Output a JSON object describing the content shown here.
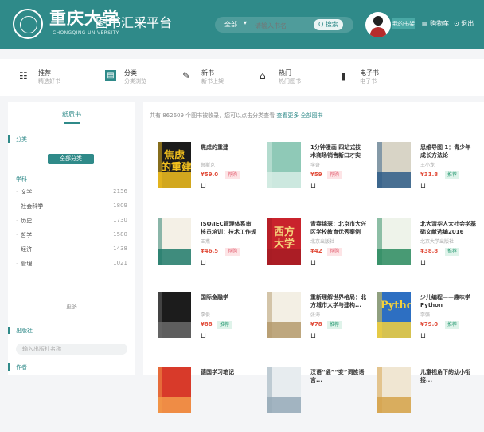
{
  "header": {
    "brand": "重庆大学",
    "brand_sub": "CHONGQING UNIVERSITY",
    "platform": "图书汇采平台",
    "search": {
      "scope": "全部",
      "scope_icon": "chevron-down-icon",
      "placeholder": "请输入书名",
      "button": "Q 搜索"
    },
    "badge": "我的书架",
    "links": [
      "▤ 购物车",
      "⊙ 退出"
    ]
  },
  "categories": [
    {
      "title": "推荐",
      "sub": "精选好书",
      "icon": "grid-icon",
      "glyph": "☷",
      "active": false
    },
    {
      "title": "分类",
      "sub": "分类浏览",
      "icon": "book-icon",
      "glyph": "▤",
      "active": true
    },
    {
      "title": "新书",
      "sub": "新书上架",
      "icon": "new-book-icon",
      "glyph": "✎",
      "active": false
    },
    {
      "title": "热门",
      "sub": "热门图书",
      "icon": "fire-icon",
      "glyph": "⌂",
      "active": false
    },
    {
      "title": "电子书",
      "sub": "电子书",
      "icon": "ebook-icon",
      "glyph": "▮",
      "active": false
    }
  ],
  "sidebar": {
    "title": "纸质书",
    "section1": "分类",
    "all_button": "全部分类",
    "subjects_heading": "学科",
    "subjects": [
      {
        "name": "文学",
        "count": "2156"
      },
      {
        "name": "社会科学",
        "count": "1809"
      },
      {
        "name": "历史",
        "count": "1730"
      },
      {
        "name": "哲学",
        "count": "1580"
      },
      {
        "name": "经济",
        "count": "1438"
      },
      {
        "name": "管理",
        "count": "1021"
      }
    ],
    "more": "更多",
    "section2": "出版社",
    "search_placeholder": "输入出版社名称",
    "section3": "作者"
  },
  "main": {
    "summary": "共有 862609 个图书被收录，您可以点击分类查看",
    "summary_link": "查看更多 全部图书",
    "books": [
      {
        "title": "焦虑的重建",
        "author": "鲁斯克",
        "price": "¥59.0",
        "tag": "荐购",
        "tag_kind": "pink",
        "cover_bg": "#1b1b1b",
        "cover_accent": "#f2c01e",
        "cover_text": "焦虑\n的重建",
        "cover_text_color": "#f2c01e"
      },
      {
        "title": "1分钟漫画 四站式技术商场销售新口才实务...",
        "author": "李奇",
        "price": "¥59",
        "tag": "荐购",
        "tag_kind": "pink",
        "cover_bg": "#8fc9b7",
        "cover_accent": "#d7ede6",
        "cover_text": "",
        "cover_text_color": "#ffffff"
      },
      {
        "title": "思维导图 1：青少年成长方法论",
        "author": "王小龙",
        "price": "¥31.8",
        "tag": "推荐",
        "tag_kind": "green",
        "cover_bg": "#d8d4c6",
        "cover_accent": "#2f5d88",
        "cover_text": "",
        "cover_text_color": "#ffffff"
      },
      {
        "title": "ISO/IEC管理体系审核员培训：技术工作规范（第...",
        "author": "王燕",
        "price": "¥46.5",
        "tag": "荐购",
        "tag_kind": "pink",
        "cover_bg": "#f4f0e6",
        "cover_accent": "#1f7a6a",
        "cover_text": "",
        "cover_text_color": "#c0392b"
      },
      {
        "title": "青春锦瑟：北京市大兴区学校教育优秀案例",
        "author": "北京出版社",
        "price": "¥42",
        "tag": "荐购",
        "tag_kind": "pink",
        "cover_bg": "#c9232c",
        "cover_accent": "#a61c24",
        "cover_text": "西方\n大学",
        "cover_text_color": "#f4d27a"
      },
      {
        "title": "北大清华人大社会学基础文献选编2016（第...",
        "author": "北京大学出版社",
        "price": "¥38.8",
        "tag": "推荐",
        "tag_kind": "green",
        "cover_bg": "#eef3ea",
        "cover_accent": "#2a8a5f",
        "cover_text": "",
        "cover_text_color": "#2a8a5f"
      },
      {
        "title": "国际金融学",
        "author": "李俊",
        "price": "¥88",
        "tag": "推荐",
        "tag_kind": "green",
        "cover_bg": "#1c1c1c",
        "cover_accent": "#6a6a6a",
        "cover_text": "",
        "cover_text_color": "#ffffff"
      },
      {
        "title": "重新理解世界格局：北方城市大学与建构...",
        "author": "张海",
        "price": "¥78",
        "tag": "推荐",
        "tag_kind": "green",
        "cover_bg": "#f3efe4",
        "cover_accent": "#b49a6c",
        "cover_text": "",
        "cover_text_color": "#555555"
      },
      {
        "title": "少儿编程——趣味学Python",
        "author": "李强",
        "price": "¥79.0",
        "tag": "推荐",
        "tag_kind": "green",
        "cover_bg": "#2d6fc2",
        "cover_accent": "#f4d13c",
        "cover_text": "Python",
        "cover_text_color": "#f4d13c"
      },
      {
        "title": "德国学习笔记",
        "author": "",
        "price": "",
        "tag": "",
        "tag_kind": "pink",
        "cover_bg": "#d83a2a",
        "cover_accent": "#f39b4a",
        "cover_text": "",
        "cover_text_color": "#ffffff"
      },
      {
        "title": "汉语“通”“变”词族语言...",
        "author": "",
        "price": "",
        "tag": "",
        "tag_kind": "pink",
        "cover_bg": "#e7ecef",
        "cover_accent": "#95aab8",
        "cover_text": "",
        "cover_text_color": "#ffffff"
      },
      {
        "title": "儿童视角下的幼小衔接...",
        "author": "",
        "price": "",
        "tag": "",
        "tag_kind": "pink",
        "cover_bg": "#f0e6d2",
        "cover_accent": "#d5a24a",
        "cover_text": "",
        "cover_text_color": "#ffffff"
      }
    ]
  },
  "colors": {
    "brand": "#2f8a89",
    "price": "#e14d3b",
    "tag_pink_bg": "#fde4e6",
    "tag_pink_text": "#e46a7a",
    "tag_green_bg": "#dff3ea",
    "tag_green_text": "#2e9d77"
  }
}
